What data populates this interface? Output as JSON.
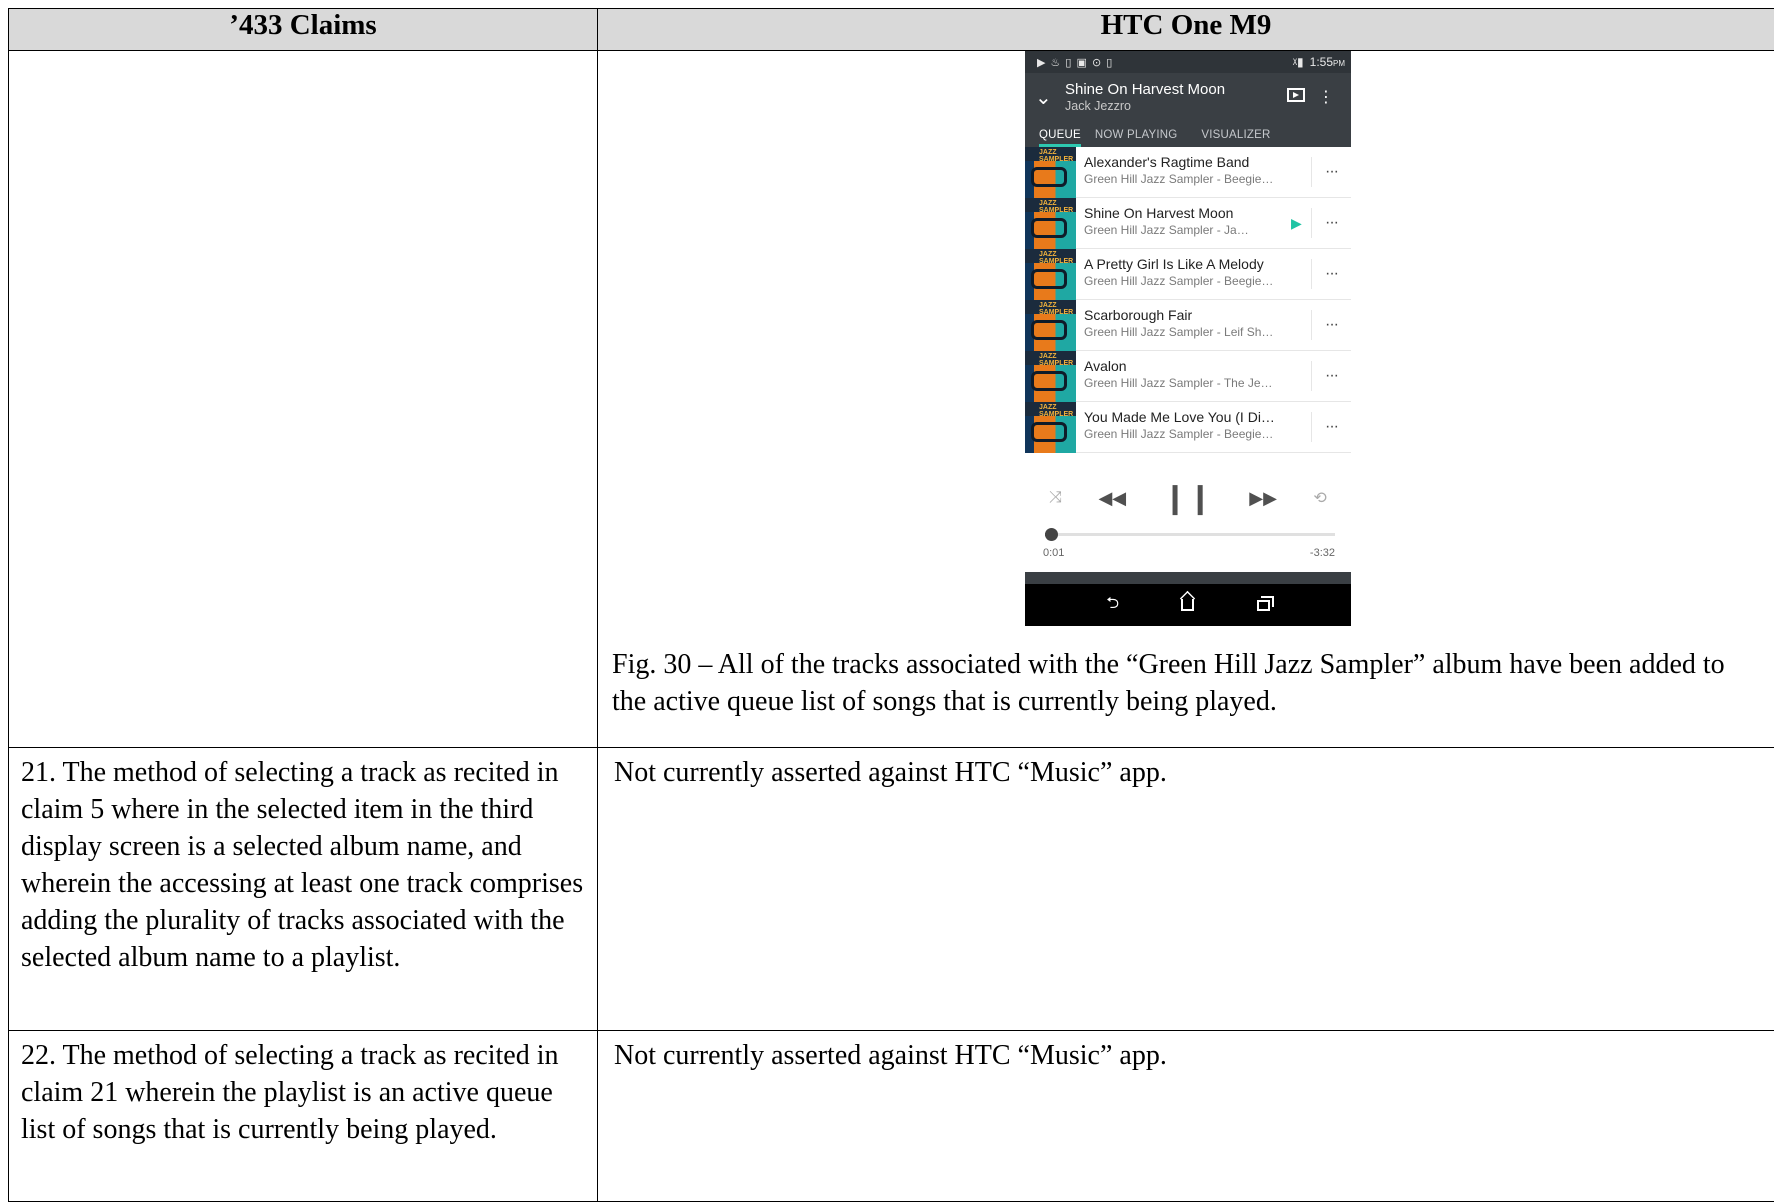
{
  "table": {
    "header_left": "’433 Claims",
    "header_right": "HTC One M9",
    "figure_caption": "Fig. 30 – All of the tracks associated with the “Green Hill Jazz Sampler” album have been added to the active queue list of songs that is currently being played.",
    "rows": [
      {
        "claim": "21. The method of selecting a track as recited in claim 5 where in the selected item in the third display screen is a selected album name, and wherein the accessing at least one track comprises adding the plurality of tracks associated with the selected album name to a playlist.",
        "response": "Not currently asserted against HTC “Music” app."
      },
      {
        "claim": "22. The method of selecting a track as recited in claim 21 wherein the playlist is an active queue list of songs that is currently being played.",
        "response": "Not currently asserted against HTC “Music” app."
      }
    ]
  },
  "phone": {
    "status": {
      "icons": "▶ ♨ ▯ ▣ ⊙ ▯",
      "signal": "ᵡ▮",
      "time": "1:55",
      "ampm": "PM"
    },
    "header": {
      "title": "Shine On Harvest Moon",
      "artist": "Jack Jezzro"
    },
    "tabs": [
      {
        "label": "QUEUE"
      },
      {
        "label": "NOW PLAYING"
      },
      {
        "label": "VISUALIZER"
      }
    ],
    "queue": [
      {
        "title": "Alexander's Ragtime Band",
        "subtitle": "Green Hill Jazz Sampler - Beegie…",
        "playing": false
      },
      {
        "title": "Shine On Harvest Moon",
        "subtitle": "Green Hill Jazz Sampler - Ja…",
        "playing": true
      },
      {
        "title": "A Pretty Girl Is Like A Melody",
        "subtitle": "Green Hill Jazz Sampler - Beegie…",
        "playing": false
      },
      {
        "title": "Scarborough Fair",
        "subtitle": "Green Hill Jazz Sampler - Leif Sh…",
        "playing": false
      },
      {
        "title": "Avalon",
        "subtitle": "Green Hill Jazz Sampler - The Je…",
        "playing": false
      },
      {
        "title": "You Made Me Love You (I Di…",
        "subtitle": "Green Hill Jazz Sampler - Beegie…",
        "playing": false
      }
    ],
    "album_art_label": "JAZZ SAMPLER",
    "more_glyph": "···",
    "play_glyph": "▶",
    "controls": {
      "shuffle": "⤨",
      "prev": "◀◀",
      "pause": "❙❙",
      "next": "▶▶",
      "repeat": "⟲"
    },
    "progress": {
      "elapsed": "0:01",
      "remaining": "-3:32",
      "fraction": 0.005
    },
    "nav": {
      "back": "⮌"
    },
    "accent_color": "#2ec8b0"
  }
}
